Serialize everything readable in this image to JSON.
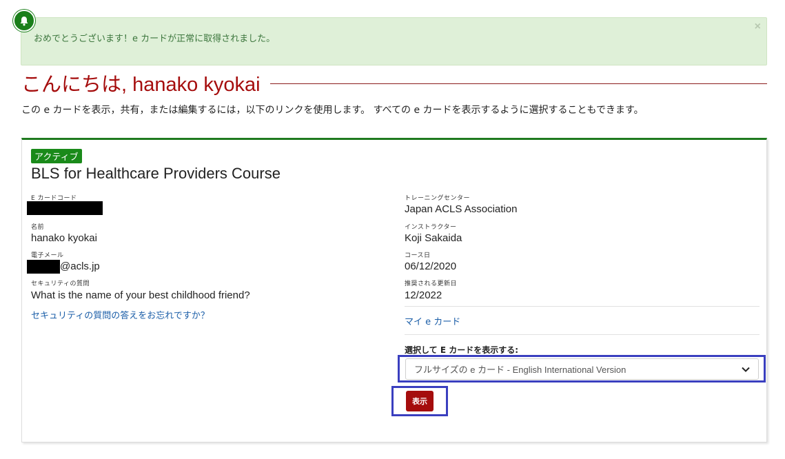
{
  "alert": {
    "message": "おめでとうございます！e カードが正常に取得されました。",
    "close_glyph": "×"
  },
  "greeting": "こんにちは, hanako kyokai",
  "intro": "この e カードを表示，共有，または編集するには，以下のリンクを使用します。 すべての e カードを表示するように選択することもできます。",
  "card": {
    "status_badge": "アクティブ",
    "course_title": "BLS for Healthcare Providers Course",
    "left_fields": {
      "ecard_code_label": "E カードコード",
      "name_label": "名前",
      "name_value": "hanako kyokai",
      "email_label": "電子メール",
      "email_domain": "@acls.jp",
      "security_label": "セキュリティの質問",
      "security_value": "What is the name of your best childhood friend?",
      "forgot_link": "セキュリティの質問の答えをお忘れですか？"
    },
    "right_fields": {
      "training_center_label": "トレーニングセンター",
      "training_center_value": "Japan ACLS Association",
      "instructor_label": "インストラクター",
      "instructor_value": "Koji Sakaida",
      "course_date_label": "コース日",
      "course_date_value": "06/12/2020",
      "renewal_label": "推奨される更新日",
      "renewal_value": "12/2022",
      "my_ecards_link": "マイ e カード"
    },
    "view_select": {
      "label": "選択して E カードを表示する:",
      "selected": "フルサイズの e カード - English International Version"
    },
    "show_button": "表示"
  },
  "icons": {
    "bell": "bell-icon",
    "dropdown": "chevron-down-icon"
  },
  "colors": {
    "accent_red": "#a50d0d",
    "active_green": "#1a8a1a",
    "alert_bg": "#dff0d8",
    "highlight_blue": "#3a3fbf",
    "link_blue": "#1b5ea8"
  }
}
